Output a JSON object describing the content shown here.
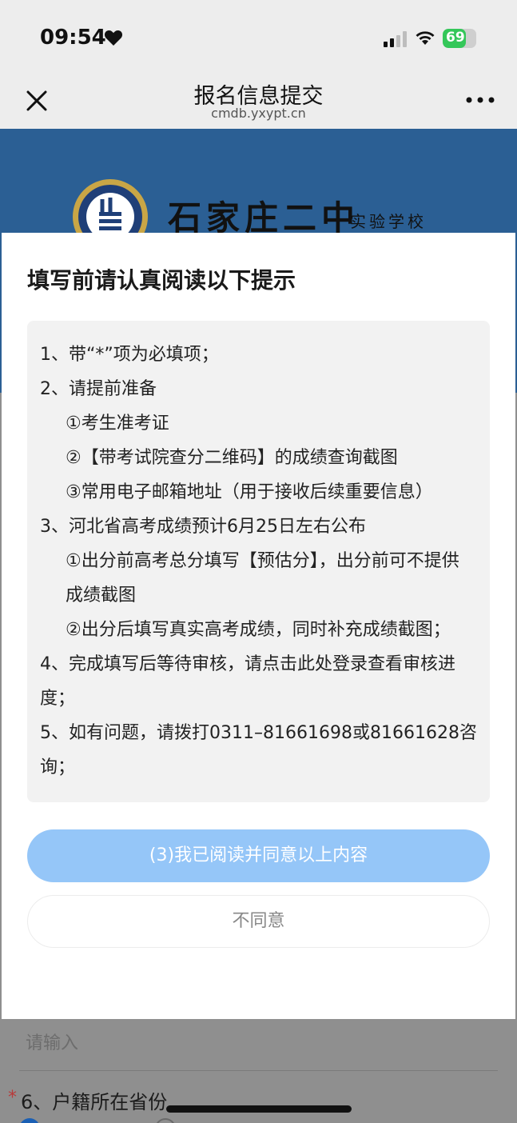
{
  "status_bar": {
    "time": "09:54",
    "battery": "69",
    "battery_level_percent": 69
  },
  "nav": {
    "title": "报名信息提交",
    "subtitle": "cmdb.yxypt.cn"
  },
  "banner": {
    "school_name": "石家庄二中",
    "school_sub": "实验学校"
  },
  "modal": {
    "title": "填写前请认真阅读以下提示",
    "lines": [
      "1、带“*”项为必填项；",
      "2、请提前准备",
      "①考生准考证",
      "②【带考试院查分二维码】的成绩查询截图",
      "③常用电子邮箱地址（用于接收后续重要信息）",
      "3、河北省高考成绩预计6月25日左右公布",
      "①出分前高考总分填写【预估分】，出分前可不提供",
      "成绩截图",
      "②出分后填写真实高考成绩，同时补充成绩截图；",
      "4、完成填写后等待审核，请点击此处登录查看审核进",
      "度；",
      "5、如有问题，请拨打0311–81661698或81661628咨",
      "询；"
    ],
    "agree_label": "(3)我已阅读并同意以上内容",
    "disagree_label": "不同意"
  },
  "form": {
    "placeholder": "请输入",
    "required_mark": "*",
    "field_label": "6、户籍所在省份"
  },
  "icons": {
    "close": "close-icon",
    "more": "more-icon",
    "heart": "heart-icon",
    "signal": "signal-icon",
    "wifi": "wifi-icon",
    "battery": "battery-icon",
    "logo": "school-logo"
  },
  "colors": {
    "banner_bg": "#2b5f94",
    "agree_button_bg": "#95c6f8",
    "required_star": "#b83a3a"
  }
}
